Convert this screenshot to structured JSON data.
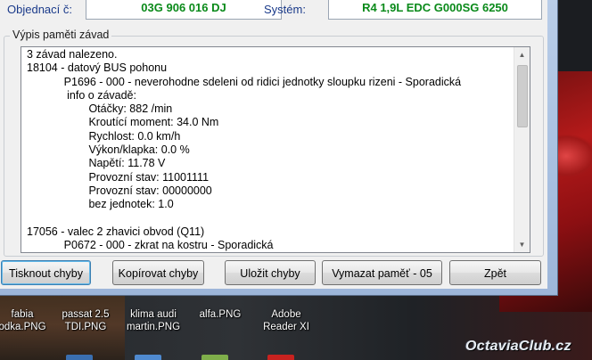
{
  "header": {
    "order_label": "Objednací č:",
    "order_value": "03G 906 016 DJ",
    "system_label": "Systém:",
    "system_value": "R4 1,9L EDC G000SG  6250"
  },
  "memory_group": {
    "title": "Výpis paměti závad",
    "lines": [
      "3 závad nalezeno.",
      "18104 - datový BUS pohonu",
      "            P1696 - 000 - neverohodne sdeleni od ridici jednotky sloupku rizeni - Sporadická",
      "             info o závadě:",
      "                    Otáčky: 882 /min",
      "                    Kroutící moment: 34.0 Nm",
      "                    Rychlost: 0.0 km/h",
      "                    Výkon/klapka: 0.0 %",
      "                    Napětí: 11.78 V",
      "                    Provozní stav: 11001111",
      "                    Provozní stav: 00000000",
      "                    bez jednotek: 1.0",
      "",
      "17056 - valec 2 zhavici obvod (Q11)",
      "            P0672 - 000 - zkrat na kostru - Sporadická"
    ],
    "scrollbar": {
      "position_fraction": 0.0
    }
  },
  "buttons": {
    "print": "Tisknout chyby",
    "copy": "Kopírovat chyby",
    "save": "Uložit chyby",
    "clear": "Vymazat paměť - 05",
    "back": "Zpět"
  },
  "desktop": {
    "icons": [
      {
        "label": "fabia\nodka.PNG"
      },
      {
        "label": "passat 2.5\nTDI.PNG"
      },
      {
        "label": "klima audi\nmartin.PNG"
      },
      {
        "label": "alfa.PNG"
      },
      {
        "label": "Adobe\nReader XI"
      }
    ],
    "watermark": "OctaviaClub.cz"
  },
  "colors": {
    "accent_value": "#0a8a1a",
    "label_blue": "#1a3a8a",
    "window_frame": "#a7bfe0"
  }
}
